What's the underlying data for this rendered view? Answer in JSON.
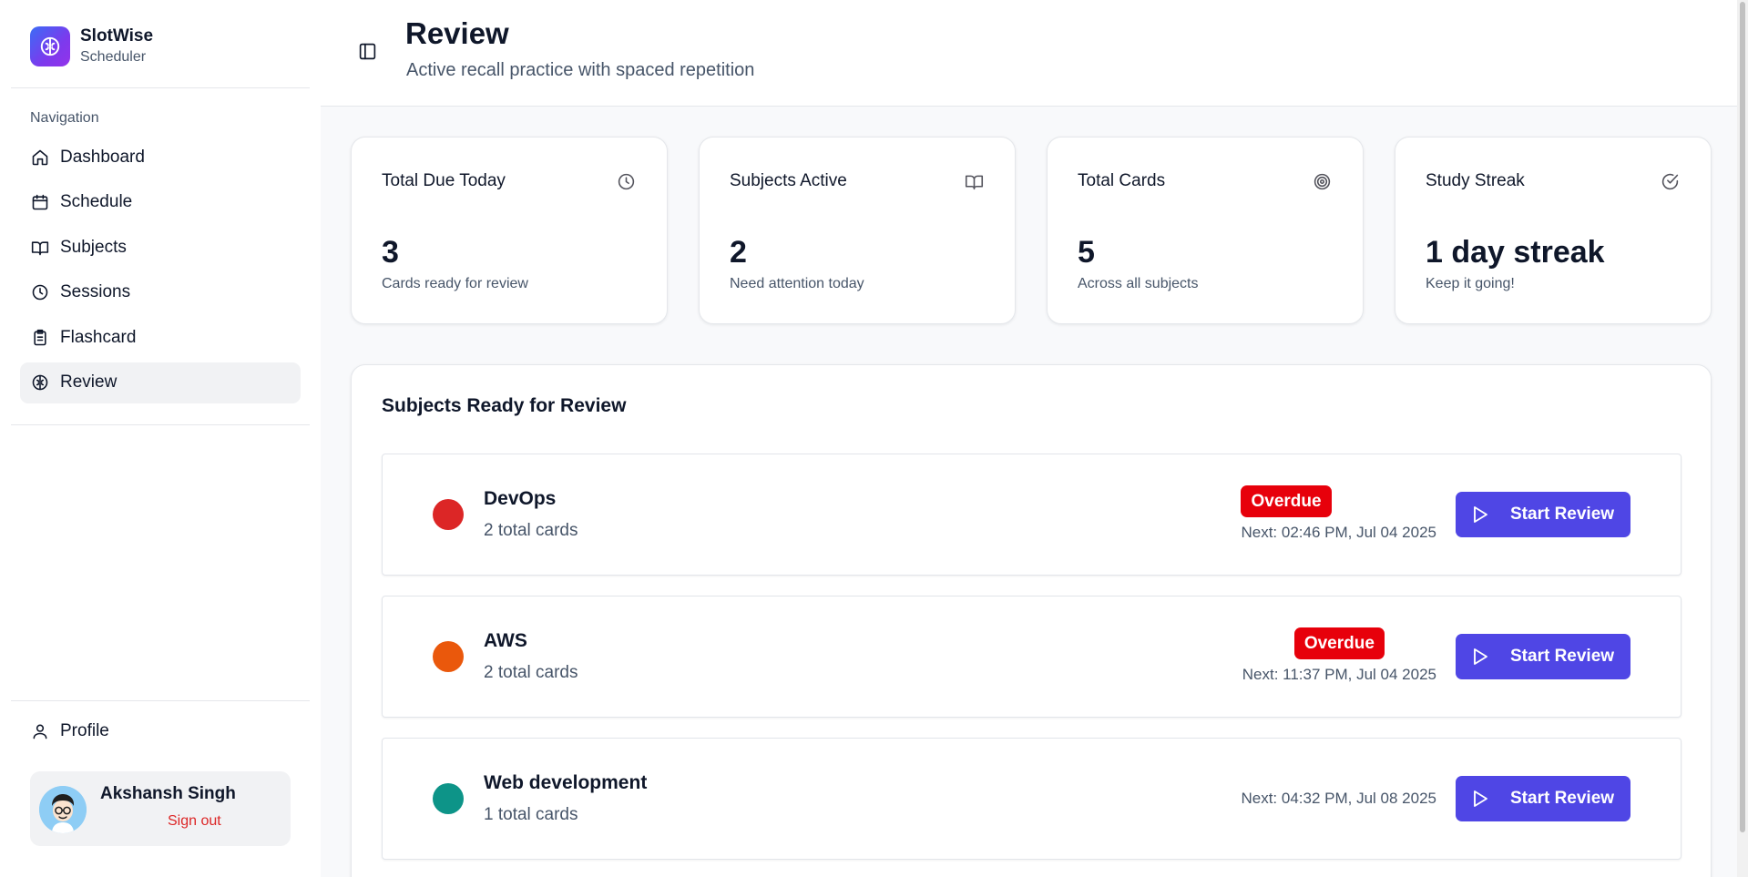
{
  "brand": {
    "name": "SlotWise",
    "subtitle": "Scheduler",
    "logo_icon": "brain-icon"
  },
  "sidebar": {
    "section_label": "Navigation",
    "items": [
      {
        "label": "Dashboard",
        "icon": "home-icon",
        "active": false
      },
      {
        "label": "Schedule",
        "icon": "calendar-icon",
        "active": false
      },
      {
        "label": "Subjects",
        "icon": "book-open-icon",
        "active": false
      },
      {
        "label": "Sessions",
        "icon": "clock-icon",
        "active": false
      },
      {
        "label": "Flashcard",
        "icon": "clipboard-icon",
        "active": false
      },
      {
        "label": "Review",
        "icon": "brain-icon",
        "active": true
      }
    ],
    "profile_label": "Profile",
    "user": {
      "name": "Akshansh Singh",
      "sign_out": "Sign out"
    }
  },
  "header": {
    "title": "Review",
    "subtitle": "Active recall practice with spaced repetition"
  },
  "stats": [
    {
      "title": "Total Due Today",
      "value": "3",
      "caption": "Cards ready for review",
      "icon": "clock-icon"
    },
    {
      "title": "Subjects Active",
      "value": "2",
      "caption": "Need attention today",
      "icon": "book-open-icon"
    },
    {
      "title": "Total Cards",
      "value": "5",
      "caption": "Across all subjects",
      "icon": "target-icon"
    },
    {
      "title": "Study Streak",
      "value": "1 day streak",
      "caption": "Keep it going!",
      "icon": "check-circle-icon"
    }
  ],
  "review_panel": {
    "title": "Subjects Ready for Review",
    "button_label": "Start Review",
    "subjects": [
      {
        "name": "DevOps",
        "count": "2 total cards",
        "color": "#dc2626",
        "badge": "Overdue",
        "next": "Next: 02:46 PM, Jul 04 2025"
      },
      {
        "name": "AWS",
        "count": "2 total cards",
        "color": "#ea580c",
        "badge": "Overdue",
        "next": "Next: 11:37 PM, Jul 04 2025"
      },
      {
        "name": "Web development",
        "count": "1 total cards",
        "color": "#0d9488",
        "badge": "",
        "next": "Next: 04:32 PM, Jul 08 2025"
      }
    ]
  },
  "colors": {
    "accent": "#4f46e5",
    "danger": "#e7000b"
  }
}
